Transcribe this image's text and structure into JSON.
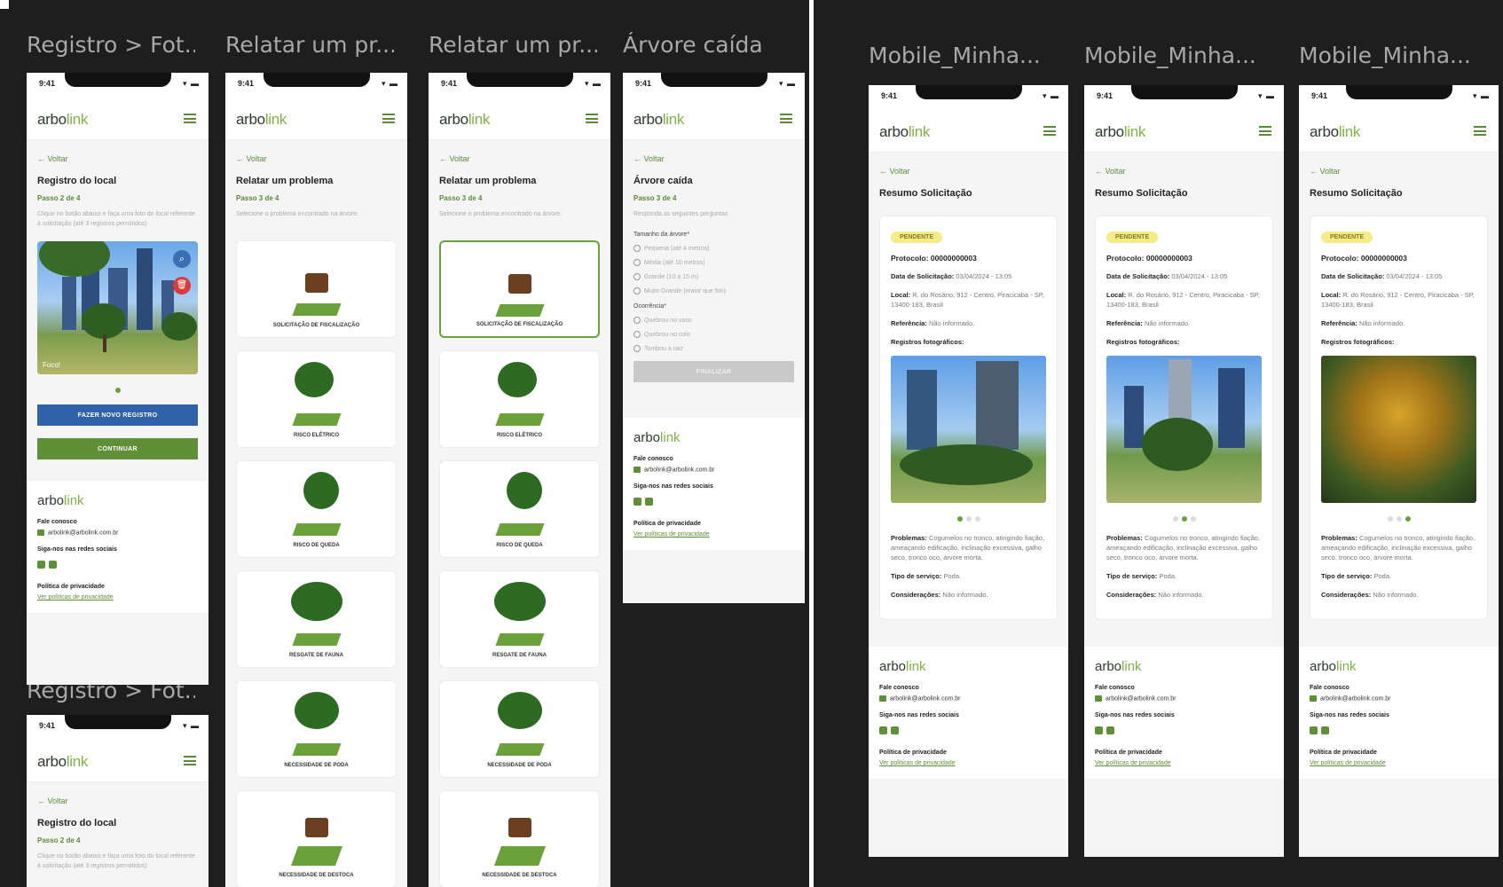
{
  "brand": {
    "logo_prefix": "arbo",
    "logo_accent": "link",
    "accent": "#5f8f36",
    "blue": "#2f62a8"
  },
  "status": {
    "time": "9:41",
    "icons": "▾ ▬"
  },
  "common": {
    "back": "← Voltar",
    "contact_label": "Fale conosco",
    "email": "arbolink@arbolink.com.br",
    "social_label": "Siga-nos nas redes sociais",
    "privacy_label": "Política de privacidade",
    "privacy_link": "Ver políticas de privacidade"
  },
  "frames": {
    "f1": {
      "title": "Registro > Fot..."
    },
    "f2": {
      "title": "Relatar um pr..."
    },
    "f3": {
      "title": "Relatar um pr..."
    },
    "f4": {
      "title": "Árvore caída"
    },
    "f5": {
      "title": "Registro > Fot..."
    },
    "r1": {
      "title": "Mobile_Minha..."
    },
    "r2": {
      "title": "Mobile_Minha..."
    },
    "r3": {
      "title": "Mobile_Minha..."
    }
  },
  "registro": {
    "heading": "Registro do local",
    "step": "Passo 2 de 4",
    "help": "Clique no botão abaixo e faça uma foto do local referente à solicitação (até 3 registros permitidos)",
    "photo_caption": "Foco!",
    "zoom_icon": "⌕",
    "delete_icon": "🗑",
    "new_record_btn": "FAZER NOVO REGISTRO",
    "continue_btn": "CONTINUAR"
  },
  "problema": {
    "heading": "Relatar um problema",
    "step": "Passo 3 de 4",
    "help": "Selecione o problema encontrado na árvore.",
    "cards": [
      "SOLICITAÇÃO DE FISCALIZAÇÃO",
      "RISCO ELÉTRICO",
      "RISCO DE QUEDA",
      "RESGATE DE FAUNA",
      "NECESSIDADE DE PODA",
      "NECESSIDADE DE DESTOCA"
    ]
  },
  "arvore": {
    "heading": "Árvore caída",
    "step": "Passo 3 de 4",
    "help": "Responda as seguintes perguntas",
    "size_label": "Tamanho da árvore*",
    "size_options": [
      "Pequena (até 4 metros)",
      "Média (até 10 metros)",
      "Grande (10 a 15 m)",
      "Muito Grande (maior que 5m)"
    ],
    "occ_label": "Ocorrência*",
    "occ_options": [
      "Quebrou no vaso",
      "Quebrou no colo",
      "Tombou a raiz"
    ],
    "finish_btn": "FINALIZAR"
  },
  "resumo": {
    "heading": "Resumo Solicitação",
    "badge": "PENDENTE",
    "protocol": "Protocolo: 00000000003",
    "date_label": "Data de Solicitação:",
    "date_value": "03/04/2024 - 13:05",
    "local_label": "Local:",
    "local_value": "R. do Rosário, 912 - Centro, Piracicaba - SP, 13400-183, Brasil",
    "ref_label": "Referência:",
    "ref_value": "Não informado.",
    "photos_label": "Registros fotográficos:",
    "problems_label": "Problemas:",
    "problems_value": "Cogumelos no tronco, atingindo fiação, ameaçando edificação, inclinação excessiva, galho seco, tronco oco, árvore morta.",
    "service_label": "Tipo de serviço:",
    "service_value": "Poda.",
    "consider_label": "Considerações:",
    "consider_value": "Não informado."
  }
}
